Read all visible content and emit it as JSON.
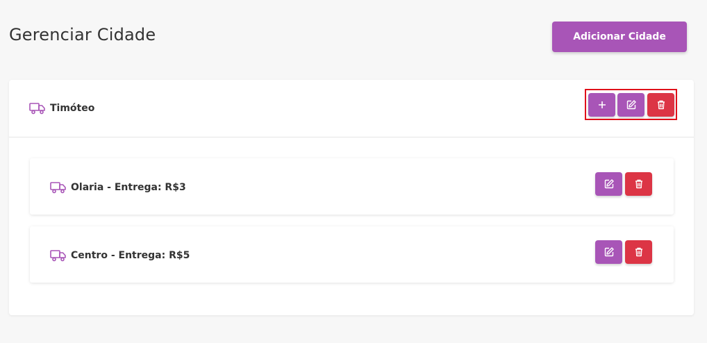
{
  "page": {
    "title": "Gerenciar Cidade",
    "add_city_label": "Adicionar Cidade"
  },
  "city": {
    "name": "Timóteo",
    "icon": "truck-icon",
    "actions": [
      "plus-icon",
      "edit-icon",
      "trash-icon"
    ],
    "districts": [
      {
        "label": "Olaria - Entrega: R$3",
        "icon": "truck-icon"
      },
      {
        "label": "Centro - Entrega: R$5",
        "icon": "truck-icon"
      }
    ]
  },
  "colors": {
    "accent": "#a855b7",
    "danger": "#dc3545",
    "highlight": "#e0101a",
    "background": "#f7f7f7"
  }
}
